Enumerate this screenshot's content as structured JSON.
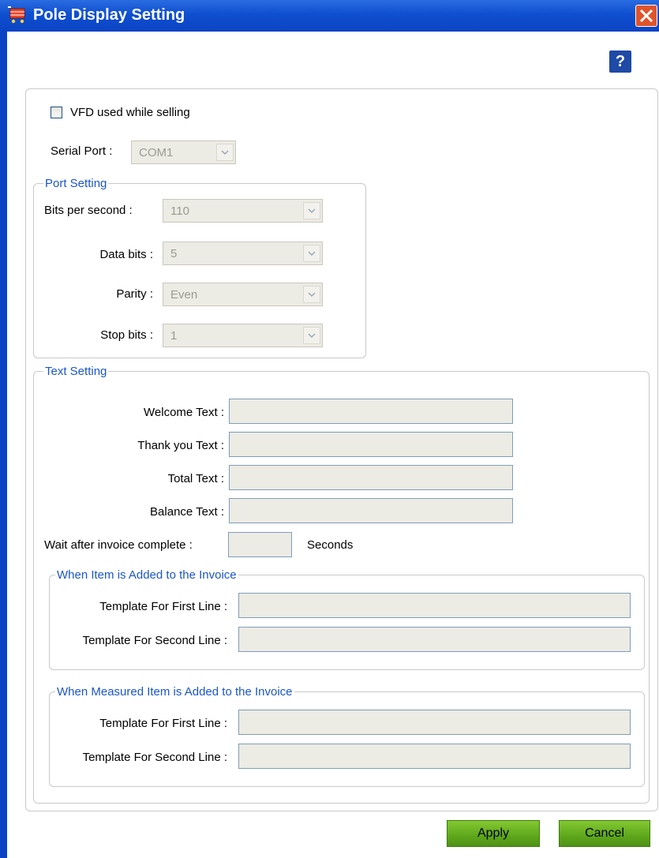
{
  "window": {
    "title": "Pole Display Setting",
    "app_icon": "shopping-cart-icon",
    "close_icon": "close-icon",
    "help_label": "?"
  },
  "vfd": {
    "label": "VFD used while selling",
    "checked": false
  },
  "serial_port": {
    "label": "Serial Port :",
    "value": "COM1"
  },
  "port_setting": {
    "title": "Port Setting",
    "bits_per_second": {
      "label": "Bits per second :",
      "value": "110"
    },
    "data_bits": {
      "label": "Data bits :",
      "value": "5"
    },
    "parity": {
      "label": "Parity :",
      "value": "Even"
    },
    "stop_bits": {
      "label": "Stop bits :",
      "value": "1"
    }
  },
  "text_setting": {
    "title": "Text Setting",
    "welcome": {
      "label": "Welcome Text :",
      "value": ""
    },
    "thank_you": {
      "label": "Thank you Text :",
      "value": ""
    },
    "total": {
      "label": "Total Text :",
      "value": ""
    },
    "balance": {
      "label": "Balance Text :",
      "value": ""
    },
    "wait": {
      "label": "Wait after invoice complete :",
      "value": "",
      "unit": "Seconds"
    },
    "item_added": {
      "title": "When Item is Added to the Invoice",
      "first_line": {
        "label": "Template For First Line :",
        "value": ""
      },
      "second_line": {
        "label": "Template For Second Line :",
        "value": ""
      }
    },
    "measured_added": {
      "title": "When Measured Item is Added to the Invoice",
      "first_line": {
        "label": "Template For First Line :",
        "value": ""
      },
      "second_line": {
        "label": "Template For Second Line :",
        "value": ""
      }
    }
  },
  "buttons": {
    "apply": "Apply",
    "cancel": "Cancel"
  },
  "colors": {
    "title_bar": "#0a44c4",
    "group_title": "#1a56c8",
    "button_green": "#5ea71c",
    "field_bg": "#ecebe4"
  }
}
